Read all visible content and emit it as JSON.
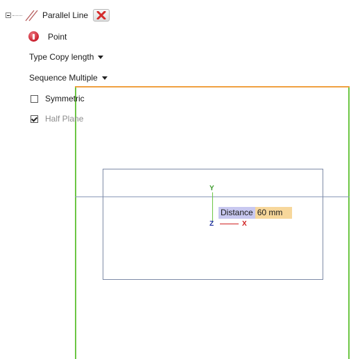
{
  "tree": {
    "parallel_line_label": "Parallel Line",
    "point_label": "Point",
    "type_label": "Type Copy length",
    "sequence_label": "Sequence Multiple",
    "symmetric_label": "Symmetric",
    "half_plane_label": "Half Plane"
  },
  "states": {
    "symmetric_checked": false,
    "half_plane_checked": true
  },
  "viewport": {
    "distance_label": "Distance",
    "distance_value": "60 mm",
    "axis_y": "Y",
    "axis_z": "Z",
    "axis_x": "X"
  },
  "icons": {
    "tree_toggle": "collapse-minus-icon",
    "parallel_line": "parallel-line-icon",
    "close": "close-x-icon",
    "point": "point-alert-icon",
    "dropdown": "chevron-down-icon"
  },
  "colors": {
    "green_line": "#6cc644",
    "orange_line": "#f0a040",
    "blue_line": "#8a9ab8",
    "distance_label_bg": "#c8c8f0",
    "distance_value_bg": "#f7d79b",
    "axis_x": "#d02020",
    "axis_y": "#3a9a2a",
    "axis_z": "#2030a0"
  }
}
